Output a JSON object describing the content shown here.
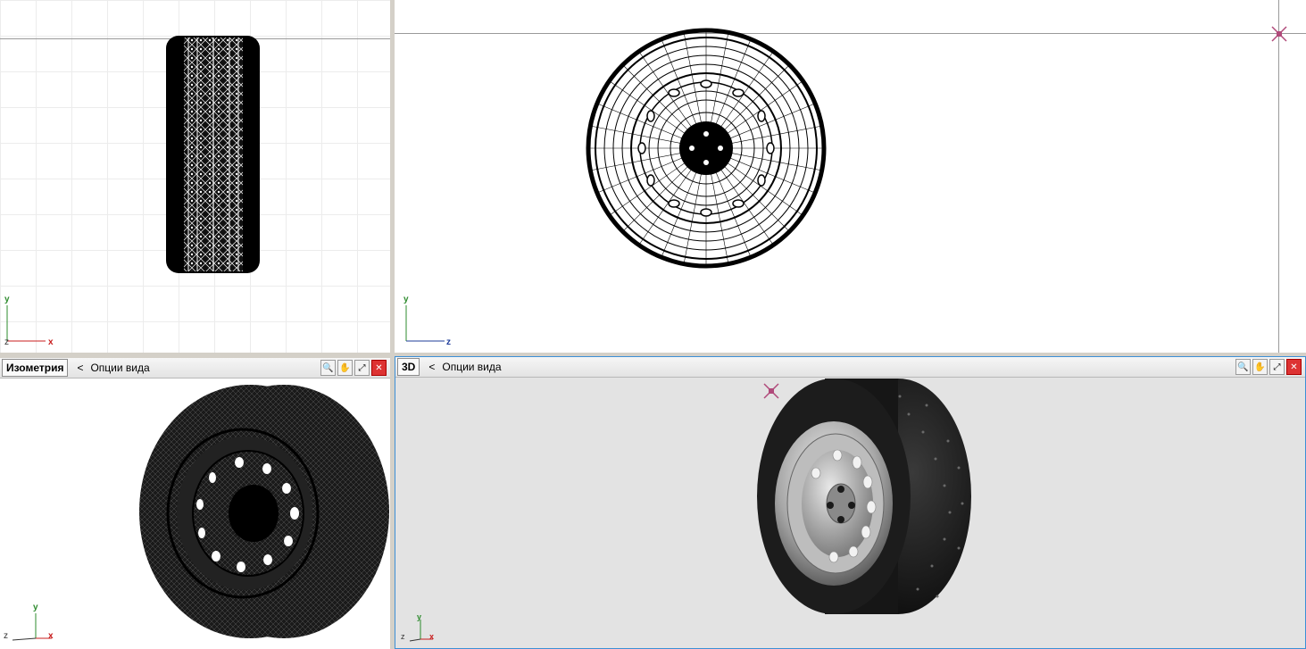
{
  "viewports": {
    "top_left": {
      "axis": {
        "vertical": "y",
        "horizontal": "x",
        "depth": "z"
      }
    },
    "top_right": {
      "axis": {
        "vertical": "y",
        "horizontal": "z"
      }
    },
    "bottom_left": {
      "title": "Изометрия",
      "options_arrow": "<",
      "options_label": "Опции вида",
      "axis": {
        "vertical": "y",
        "horizontal": "x",
        "depth": "z"
      }
    },
    "bottom_right": {
      "title": "3D",
      "options_arrow": "<",
      "options_label": "Опции вида",
      "axis": {
        "vertical": "y",
        "horizontal": "x",
        "depth": "z"
      }
    }
  },
  "toolbar_icons": [
    "zoom-icon",
    "pan-hand-icon",
    "fit-view-icon",
    "close-view-icon"
  ],
  "colors": {
    "axis_y": "#2e8b2e",
    "axis_x": "#c81e1e",
    "active_viewport_border": "#3c8fd6",
    "grid_line": "#9a9a9a",
    "render_background": "#e3e3e3"
  }
}
